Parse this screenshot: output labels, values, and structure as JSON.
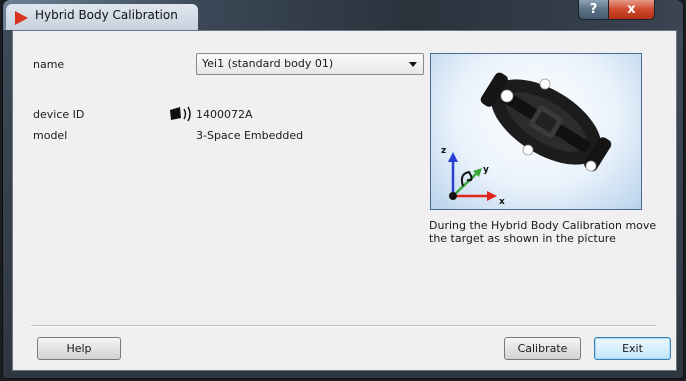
{
  "window": {
    "title": "Hybrid Body Calibration"
  },
  "title_buttons": {
    "help": "?",
    "close": "x"
  },
  "form": {
    "name_label": "name",
    "name_value": "Yei1 (standard body 01)",
    "device_id_label": "device ID",
    "device_id_value": "1400072A",
    "model_label": "model",
    "model_value": "3-Space Embedded"
  },
  "illustration": {
    "axis_x": "x",
    "axis_y": "y",
    "axis_z": "z"
  },
  "caption": "During the Hybrid Body Calibration move the target as shown in the picture",
  "buttons": {
    "help": "Help",
    "calibrate": "Calibrate",
    "exit": "Exit"
  },
  "colors": {
    "accent": "#d8321e",
    "axis_x": "#e0261c",
    "axis_y": "#3aa63a",
    "axis_z": "#2a3fd0"
  }
}
